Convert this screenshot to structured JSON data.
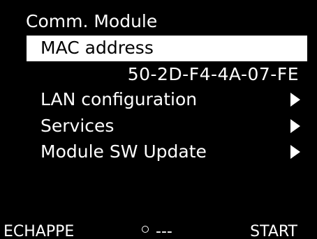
{
  "screen": {
    "title": "Comm. Module",
    "background": "#000000",
    "foreground": "#ffffff"
  },
  "menu": {
    "selected": {
      "label": "MAC address",
      "value": "50-2D-F4-4A-07-FE"
    },
    "items": [
      {
        "label": "LAN configuration",
        "icon": "triangle-right-icon"
      },
      {
        "label": "Services",
        "icon": "triangle-right-icon"
      },
      {
        "label": "Module SW Update",
        "icon": "triangle-right-icon"
      }
    ]
  },
  "softkeys": {
    "left": "ECHAPPE",
    "center": "---",
    "center_icon": "circle-icon",
    "right": "START"
  }
}
